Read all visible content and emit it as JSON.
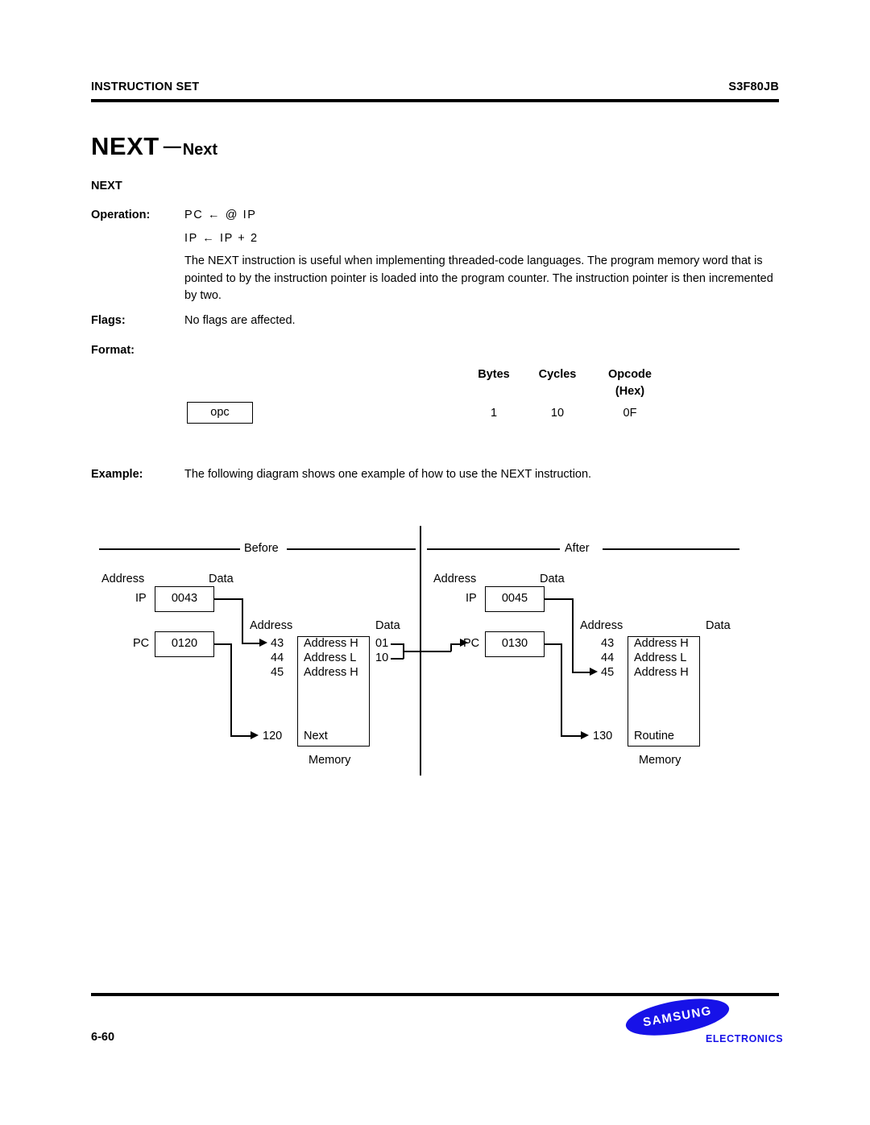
{
  "header": {
    "left": "INSTRUCTION SET",
    "right": "S3F80JB"
  },
  "title": {
    "mnemonic": "NEXT",
    "dash": "—",
    "name": "Next"
  },
  "section_label": "NEXT",
  "rows": {
    "operation_label": "Operation:",
    "operation_line1": "PC  ←  @ IP",
    "operation_line2": "IP  ←  IP  +  2",
    "description": "The NEXT instruction is useful when implementing threaded-code languages. The program memory word that is pointed to by the instruction pointer is loaded into the program counter. The instruction pointer is then incremented by two.",
    "flags_label": "Flags:",
    "flags_value": "No flags are affected.",
    "format_label": "Format:",
    "example_label": "Example:",
    "example_value": "The following diagram shows one example of how to use the  NEXT instruction."
  },
  "format_table": {
    "headers": [
      "Bytes",
      "Cycles",
      "Opcode",
      "(Hex)"
    ],
    "opcode_box": "opc",
    "bytes": "1",
    "cycles": "10",
    "opcode_hex": "0F"
  },
  "diagram": {
    "before": {
      "caption": "Before",
      "address_label": "Address",
      "data_label": "Data",
      "mem_address_label": "Address",
      "mem_data_label": "Data",
      "memory_caption": "Memory",
      "registers": [
        {
          "name": "IP",
          "value": "0043"
        },
        {
          "name": "PC",
          "value": "0120"
        }
      ],
      "memory_rows": [
        {
          "address": "43",
          "content": "Address H",
          "data": "01"
        },
        {
          "address": "44",
          "content": "Address L",
          "data": "10"
        },
        {
          "address": "45",
          "content": "Address H",
          "data": ""
        }
      ],
      "target_row": {
        "address": "120",
        "content": "Next"
      }
    },
    "after": {
      "caption": "After",
      "address_label": "Address",
      "data_label": "Data",
      "mem_address_label": "Address",
      "mem_data_label": "Data",
      "memory_caption": "Memory",
      "registers": [
        {
          "name": "IP",
          "value": "0045"
        },
        {
          "name": "PC",
          "value": "0130"
        }
      ],
      "memory_rows": [
        {
          "address": "43",
          "content": "Address H"
        },
        {
          "address": "44",
          "content": "Address L"
        },
        {
          "address": "45",
          "content": "Address H"
        }
      ],
      "target_row": {
        "address": "130",
        "content": "Routine"
      }
    }
  },
  "footer": {
    "page_number": "6-60",
    "brand": "SAMSUNG",
    "brand_sub": "ELECTRONICS",
    "brand_color": "#1712e8"
  }
}
